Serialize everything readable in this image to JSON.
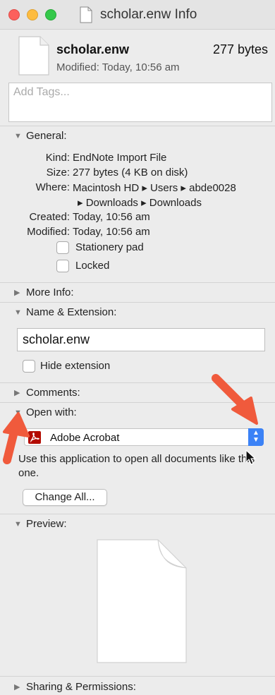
{
  "window": {
    "title": "scholar.enw Info"
  },
  "file": {
    "name": "scholar.enw",
    "size": "277 bytes",
    "modified": "Modified: Today, 10:56 am"
  },
  "tags": {
    "placeholder": "Add Tags..."
  },
  "general": {
    "header": "General:",
    "rows": [
      {
        "label": "Kind:",
        "value": "EndNote Import File"
      },
      {
        "label": "Size:",
        "value": "277 bytes (4 KB on disk)"
      },
      {
        "label": "Where:",
        "value": "Macintosh HD ▸ Users ▸ abde0028"
      },
      {
        "label": "",
        "value": "▸ Downloads ▸ Downloads"
      },
      {
        "label": "Created:",
        "value": "Today, 10:56 am"
      },
      {
        "label": "Modified:",
        "value": "Today, 10:56 am"
      }
    ],
    "stationery_label": "Stationery pad",
    "locked_label": "Locked",
    "stationery_checked": false,
    "locked_checked": false
  },
  "more_info": {
    "header": "More Info:"
  },
  "name_ext": {
    "header": "Name & Extension:",
    "value": "scholar.enw",
    "hide_ext_label": "Hide extension",
    "hide_ext_checked": false
  },
  "comments": {
    "header": "Comments:"
  },
  "open_with": {
    "header": "Open with:",
    "app": "Adobe Acrobat",
    "description": "Use this application to open all documents like this one.",
    "change_all": "Change All..."
  },
  "preview": {
    "header": "Preview:"
  },
  "sharing": {
    "header": "Sharing & Permissions:"
  },
  "colors": {
    "accent": "#3b82f6",
    "annotation_arrow": "#f05a3c",
    "acrobat": "#b30b00"
  },
  "icons": {
    "disclosure_open": "disclosure-open-icon",
    "disclosure_closed": "disclosure-closed-icon",
    "document": "document-icon",
    "acrobat": "acrobat-icon"
  }
}
